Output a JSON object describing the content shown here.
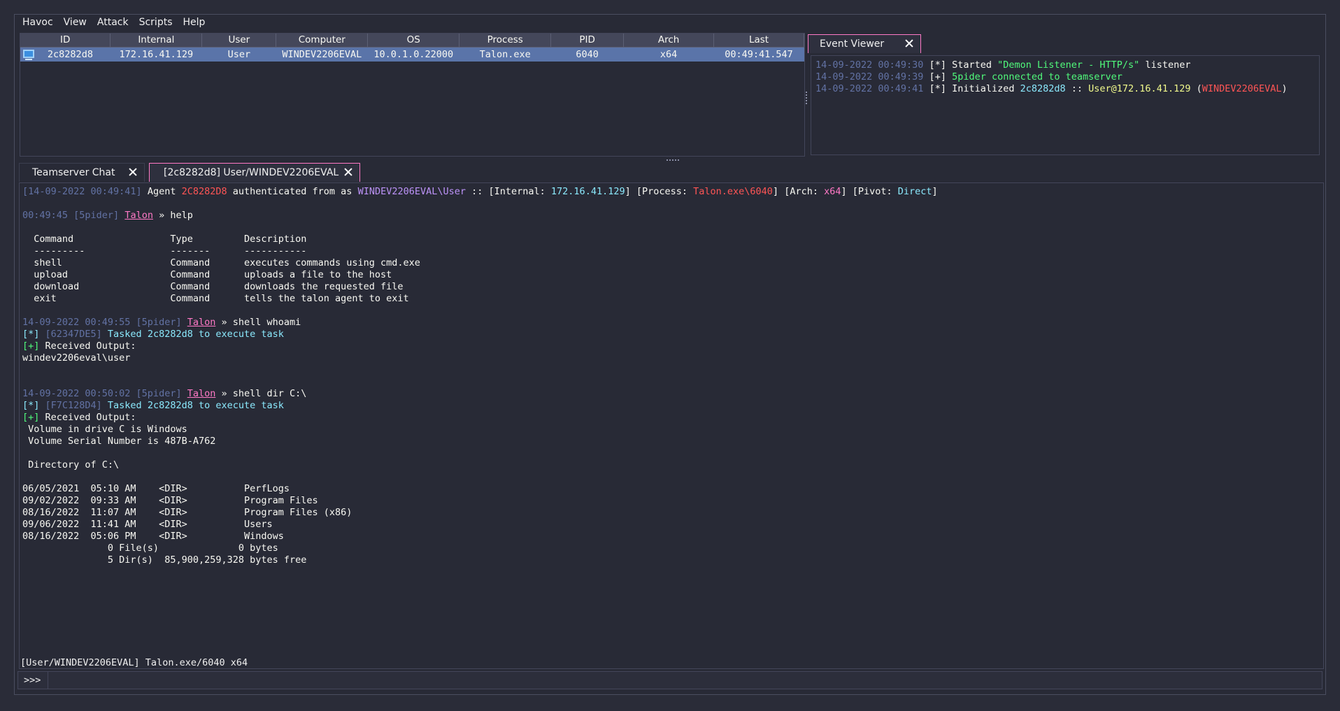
{
  "menu": [
    "Havoc",
    "View",
    "Attack",
    "Scripts",
    "Help"
  ],
  "sessions": {
    "columns": [
      "ID",
      "Internal",
      "User",
      "Computer",
      "OS",
      "Process",
      "PID",
      "Arch",
      "Last"
    ],
    "rows": [
      [
        "2c8282d8",
        "172.16.41.129",
        "User",
        "WINDEV2206EVAL",
        "10.0.1.0.22000",
        "Talon.exe",
        "6040",
        "x64",
        "00:49:41.547"
      ]
    ]
  },
  "event_viewer": {
    "tab_label": "Event Viewer",
    "lines": [
      [
        {
          "t": "14-09-2022 00:49:30 ",
          "c": "c-dim"
        },
        {
          "t": "[*] Started ",
          "c": "c-white"
        },
        {
          "t": "\"Demon Listener - HTTP/s\"",
          "c": "c-green"
        },
        {
          "t": " listener",
          "c": "c-white"
        }
      ],
      [
        {
          "t": "14-09-2022 00:49:39 ",
          "c": "c-dim"
        },
        {
          "t": "[+] ",
          "c": "c-white"
        },
        {
          "t": "5pider connected to teamserver",
          "c": "c-green"
        }
      ],
      [
        {
          "t": "14-09-2022 00:49:41 ",
          "c": "c-dim"
        },
        {
          "t": "[*] Initialized ",
          "c": "c-white"
        },
        {
          "t": "2c8282d8",
          "c": "c-cyan"
        },
        {
          "t": " :: ",
          "c": "c-white"
        },
        {
          "t": "User@172.16.41.129",
          "c": "c-yellow"
        },
        {
          "t": " (",
          "c": "c-white"
        },
        {
          "t": "WINDEV2206EVAL",
          "c": "c-red"
        },
        {
          "t": ")",
          "c": "c-white"
        }
      ]
    ]
  },
  "tabs": {
    "chat": "Teamserver Chat",
    "agent": "[2c8282d8] User/WINDEV2206EVAL"
  },
  "console_lines": [
    [
      {
        "t": "[14-09-2022 00:49:41]",
        "c": "c-dim"
      },
      {
        "t": " Agent ",
        "c": "c-white"
      },
      {
        "t": "2C8282D8",
        "c": "c-red"
      },
      {
        "t": " authenticated from as ",
        "c": "c-white"
      },
      {
        "t": "WINDEV2206EVAL\\User",
        "c": "c-purple"
      },
      {
        "t": " :: [Internal: ",
        "c": "c-white"
      },
      {
        "t": "172.16.41.129",
        "c": "c-cyan"
      },
      {
        "t": "] [Process: ",
        "c": "c-white"
      },
      {
        "t": "Talon.exe\\6040",
        "c": "c-red"
      },
      {
        "t": "] [Arch: ",
        "c": "c-white"
      },
      {
        "t": "x64",
        "c": "c-pink2"
      },
      {
        "t": "] [Pivot: ",
        "c": "c-white"
      },
      {
        "t": "Direct",
        "c": "c-cyan"
      },
      {
        "t": "]",
        "c": "c-white"
      }
    ],
    [],
    [
      {
        "t": "00:49:45 [5pider] ",
        "c": "c-dim"
      },
      {
        "t": "Talon",
        "c": "c-pink"
      },
      {
        "t": " » help",
        "c": "c-white"
      }
    ],
    [],
    [
      {
        "t": "  Command                 Type         Description",
        "c": "c-white"
      }
    ],
    [
      {
        "t": "  ---------               -------      -----------",
        "c": "c-white"
      }
    ],
    [
      {
        "t": "  shell                   Command      executes commands using cmd.exe",
        "c": "c-white"
      }
    ],
    [
      {
        "t": "  upload                  Command      uploads a file to the host",
        "c": "c-white"
      }
    ],
    [
      {
        "t": "  download                Command      downloads the requested file",
        "c": "c-white"
      }
    ],
    [
      {
        "t": "  exit                    Command      tells the talon agent to exit",
        "c": "c-white"
      }
    ],
    [],
    [
      {
        "t": "14-09-2022 00:49:55 [5pider] ",
        "c": "c-dim"
      },
      {
        "t": "Talon",
        "c": "c-pink"
      },
      {
        "t": " » shell whoami",
        "c": "c-white"
      }
    ],
    [
      {
        "t": "[*] ",
        "c": "c-cyan"
      },
      {
        "t": "[62347DE5] ",
        "c": "c-dim"
      },
      {
        "t": "Tasked 2c8282d8 to execute task",
        "c": "c-cyan"
      }
    ],
    [
      {
        "t": "[+] ",
        "c": "c-green"
      },
      {
        "t": "Received Output:",
        "c": "c-white"
      }
    ],
    [
      {
        "t": "windev2206eval\\user",
        "c": "c-white"
      }
    ],
    [],
    [],
    [
      {
        "t": "14-09-2022 00:50:02 [5pider] ",
        "c": "c-dim"
      },
      {
        "t": "Talon",
        "c": "c-pink"
      },
      {
        "t": " » shell dir C:\\",
        "c": "c-white"
      }
    ],
    [
      {
        "t": "[*] ",
        "c": "c-cyan"
      },
      {
        "t": "[F7C128D4] ",
        "c": "c-dim"
      },
      {
        "t": "Tasked 2c8282d8 to execute task",
        "c": "c-cyan"
      }
    ],
    [
      {
        "t": "[+] ",
        "c": "c-green"
      },
      {
        "t": "Received Output:",
        "c": "c-white"
      }
    ],
    [
      {
        "t": " Volume in drive C is Windows",
        "c": "c-white"
      }
    ],
    [
      {
        "t": " Volume Serial Number is 487B-A762",
        "c": "c-white"
      }
    ],
    [],
    [
      {
        "t": " Directory of C:\\",
        "c": "c-white"
      }
    ],
    [],
    [
      {
        "t": "06/05/2021  05:10 AM    <DIR>          PerfLogs",
        "c": "c-white"
      }
    ],
    [
      {
        "t": "09/02/2022  09:33 AM    <DIR>          Program Files",
        "c": "c-white"
      }
    ],
    [
      {
        "t": "08/16/2022  11:07 AM    <DIR>          Program Files (x86)",
        "c": "c-white"
      }
    ],
    [
      {
        "t": "09/06/2022  11:41 AM    <DIR>          Users",
        "c": "c-white"
      }
    ],
    [
      {
        "t": "08/16/2022  05:06 PM    <DIR>          Windows",
        "c": "c-white"
      }
    ],
    [
      {
        "t": "               0 File(s)              0 bytes",
        "c": "c-white"
      }
    ],
    [
      {
        "t": "               5 Dir(s)  85,900,259,328 bytes free",
        "c": "c-white"
      }
    ]
  ],
  "status_line": "[User/WINDEV2206EVAL] Talon.exe/6040 x64",
  "prompt": ">>>",
  "input_value": "",
  "icons": {
    "host": "computer-monitor-icon",
    "close": "close-icon"
  }
}
